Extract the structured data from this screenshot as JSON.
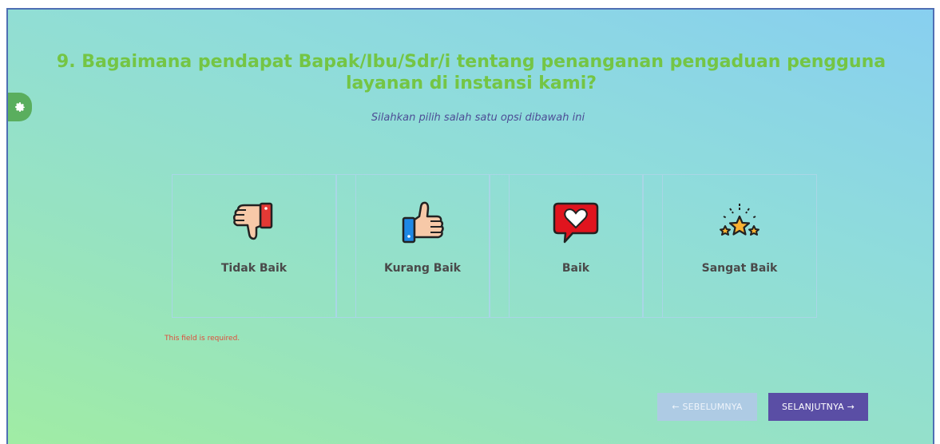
{
  "question": {
    "text": "9. Bagaimana pendapat Bapak/Ibu/Sdr/i tentang penanganan pengaduan pengguna layanan di instansi kami?",
    "instruction": "Silahkan pilih salah satu opsi dibawah ini"
  },
  "options": [
    {
      "label": "Tidak Baik",
      "icon": "thumbs-down-icon"
    },
    {
      "label": "Kurang Baik",
      "icon": "thumbs-up-icon"
    },
    {
      "label": "Baik",
      "icon": "heart-icon"
    },
    {
      "label": "Sangat Baik",
      "icon": "stars-icon"
    }
  ],
  "validation": {
    "error": "This field is required."
  },
  "navigation": {
    "prev_label": "← SEBELUMNYA",
    "next_label": "SELANJUTNYA →"
  },
  "settings": {
    "icon": "gear-icon"
  },
  "colors": {
    "question": "#74c544",
    "instruction": "#4d4d95",
    "next_button": "#5a4ea5",
    "prev_button": "#aecbe4",
    "error": "#e04b3a"
  }
}
